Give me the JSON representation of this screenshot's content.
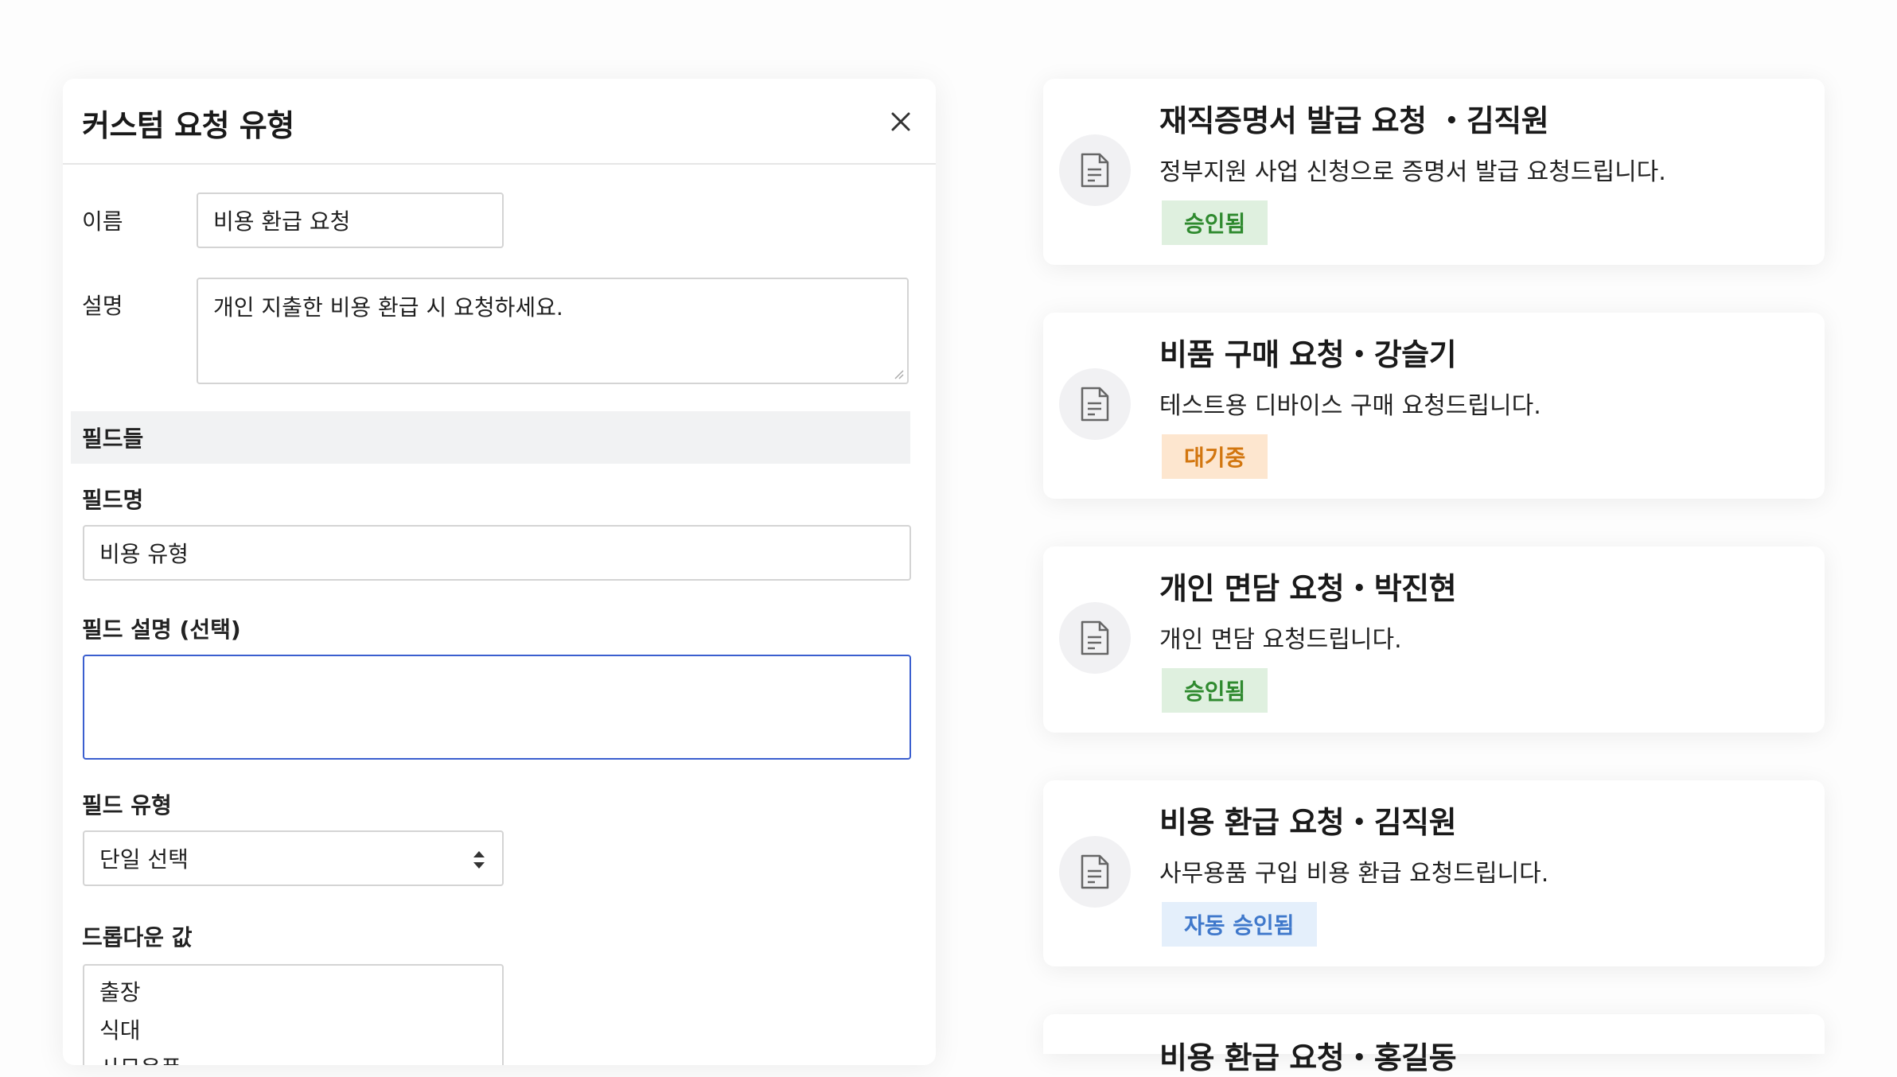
{
  "modal": {
    "title": "커스텀 요청 유형",
    "close_icon": "close-icon",
    "name_label": "이름",
    "name_value": "비용 환급 요청",
    "desc_label": "설명",
    "desc_value": "개인 지출한 비용 환급 시 요청하세요.",
    "fields_section": "필드들",
    "field_name_label": "필드명",
    "field_name_value": "비용 유형",
    "field_desc_label": "필드 설명 (선택)",
    "field_desc_value": "",
    "field_type_label": "필드 유형",
    "field_type_value": "단일 선택",
    "dropdown_label": "드롭다운 값",
    "dropdown_values": [
      "출장",
      "식대",
      "사무용품"
    ]
  },
  "requests": [
    {
      "title": "재직증명서 발급 요청 ・김직원",
      "desc": "정부지원 사업 신청으로 증명서 발급 요청드립니다.",
      "status": "승인됨",
      "status_color": "#2f8a2f",
      "icon": "document-icon"
    },
    {
      "title": "비품 구매 요청・강슬기",
      "desc": "테스트용 디바이스 구매 요청드립니다.",
      "status": "대기중",
      "status_color": "#d2760f",
      "icon": "document-icon"
    },
    {
      "title": "개인 면담 요청・박진현",
      "desc": "개인 면담 요청드립니다.",
      "status": "승인됨",
      "status_color": "#2f8a2f",
      "icon": "document-icon"
    },
    {
      "title": "비용 환급 요청・김직원",
      "desc": "사무용품 구입 비용 환급 요청드립니다.",
      "status": "자동 승인됨",
      "status_color": "#3f78cb",
      "icon": "document-icon"
    },
    {
      "title": "비용 환급 요청・홍길동"
    }
  ]
}
